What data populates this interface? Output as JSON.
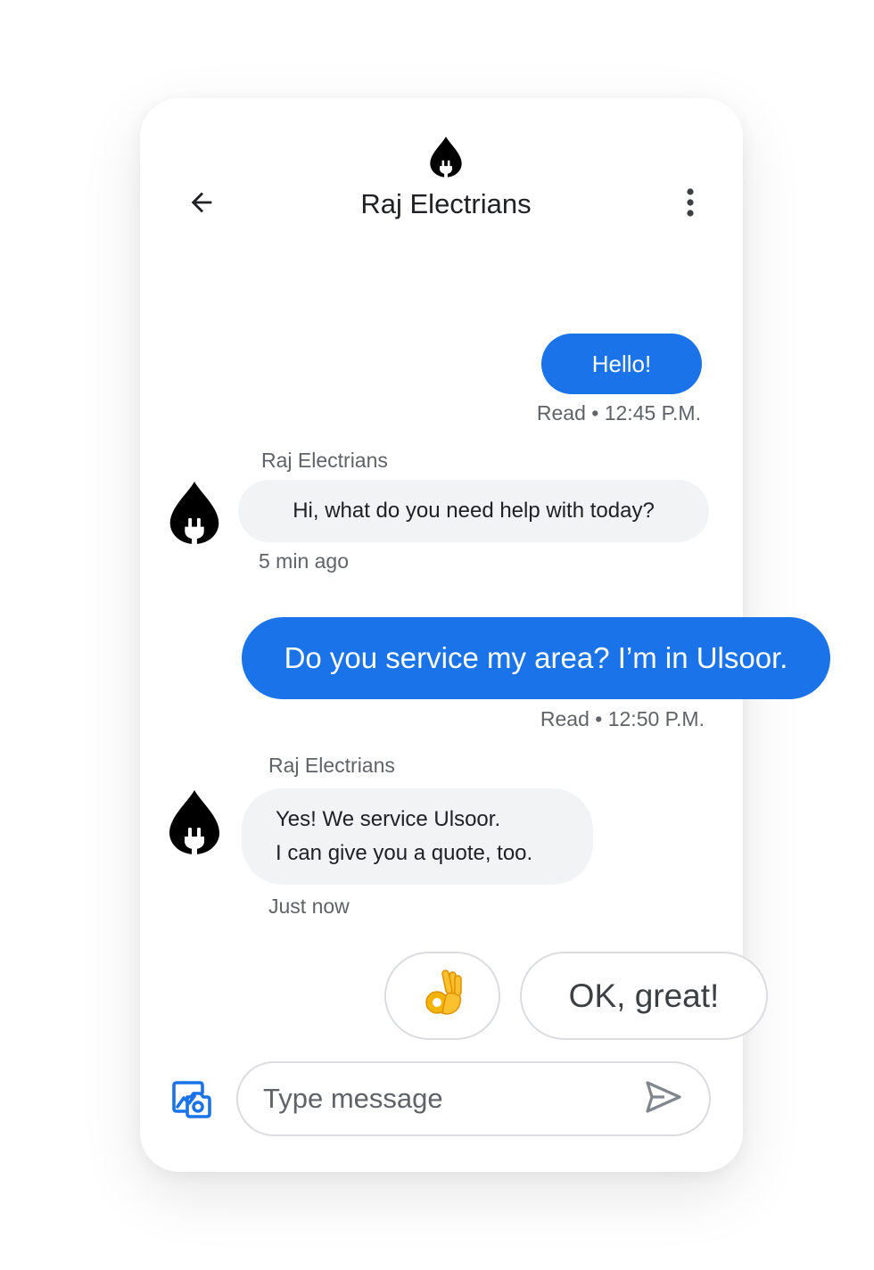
{
  "header": {
    "title": "Raj Electrians",
    "logo_icon": "flame-plug-icon",
    "back_icon": "arrow-back-icon",
    "menu_icon": "more-vert-icon"
  },
  "messages": [
    {
      "direction": "outgoing",
      "text": "Hello!",
      "meta": "Read • 12:45 P.M."
    },
    {
      "direction": "incoming",
      "sender": "Raj Electrians",
      "text": "Hi, what do you need help with today?",
      "meta": "5 min ago"
    },
    {
      "direction": "outgoing",
      "text": "Do you service my area? I’m in Ulsoor.",
      "meta": "Read • 12:50 P.M."
    },
    {
      "direction": "incoming",
      "sender": "Raj Electrians",
      "lines": [
        "Yes! We service Ulsoor.",
        "I can give you a quote, too."
      ],
      "meta": "Just now"
    }
  ],
  "suggestions": [
    "👌",
    "OK, great!"
  ],
  "composer": {
    "placeholder": "Type message",
    "value": "",
    "gallery_icon": "gallery-camera-icon",
    "send_icon": "send-icon"
  },
  "colors": {
    "accent": "#1a73e8",
    "incoming_bubble": "#f1f3f4",
    "text_primary": "#202124",
    "text_secondary": "#5f6368",
    "border": "#dadce0"
  }
}
